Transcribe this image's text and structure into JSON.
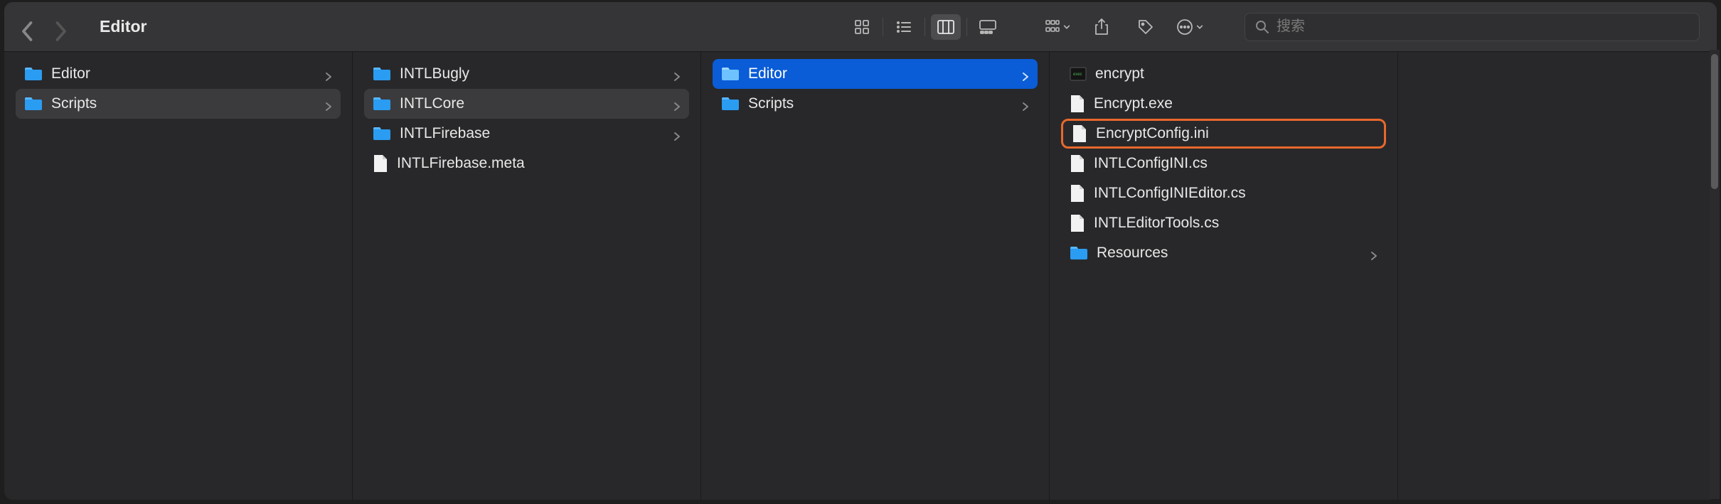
{
  "window": {
    "title": "Editor"
  },
  "search": {
    "placeholder": "搜索"
  },
  "columns": [
    {
      "items": [
        {
          "type": "folder",
          "name": "Editor",
          "hasChildren": true,
          "state": "normal"
        },
        {
          "type": "folder",
          "name": "Scripts",
          "hasChildren": true,
          "state": "selected-path"
        }
      ]
    },
    {
      "items": [
        {
          "type": "folder",
          "name": "INTLBugly",
          "hasChildren": true,
          "state": "normal"
        },
        {
          "type": "folder",
          "name": "INTLCore",
          "hasChildren": true,
          "state": "selected-path"
        },
        {
          "type": "folder",
          "name": "INTLFirebase",
          "hasChildren": true,
          "state": "normal"
        },
        {
          "type": "file",
          "name": "INTLFirebase.meta",
          "hasChildren": false,
          "state": "normal"
        }
      ]
    },
    {
      "items": [
        {
          "type": "folder",
          "name": "Editor",
          "hasChildren": true,
          "state": "selected-active"
        },
        {
          "type": "folder",
          "name": "Scripts",
          "hasChildren": true,
          "state": "normal"
        }
      ]
    },
    {
      "items": [
        {
          "type": "exec",
          "name": "encrypt",
          "hasChildren": false,
          "state": "normal"
        },
        {
          "type": "file",
          "name": "Encrypt.exe",
          "hasChildren": false,
          "state": "normal"
        },
        {
          "type": "file",
          "name": "EncryptConfig.ini",
          "hasChildren": false,
          "state": "normal",
          "highlighted": true
        },
        {
          "type": "file",
          "name": "INTLConfigINI.cs",
          "hasChildren": false,
          "state": "normal"
        },
        {
          "type": "file",
          "name": "INTLConfigINIEditor.cs",
          "hasChildren": false,
          "state": "normal"
        },
        {
          "type": "file",
          "name": "INTLEditorTools.cs",
          "hasChildren": false,
          "state": "normal"
        },
        {
          "type": "folder",
          "name": "Resources",
          "hasChildren": true,
          "state": "normal"
        }
      ]
    }
  ]
}
